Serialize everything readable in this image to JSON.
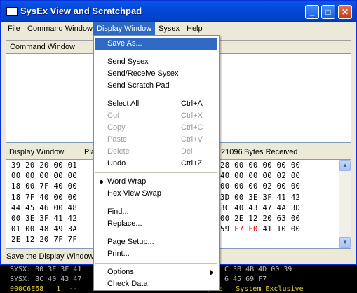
{
  "window": {
    "title": "SysEx View and Scratchpad",
    "buttons": {
      "minimize": "_",
      "maximize": "□",
      "close": "✕"
    }
  },
  "menubar": {
    "items": [
      "File",
      "Command Window",
      "Display Window",
      "Sysex",
      "Help"
    ],
    "active": "Display Window"
  },
  "command_window": {
    "label": "Command Window"
  },
  "display_window": {
    "label": "Display Window",
    "col2": "Pla",
    "bytes_count": "21096",
    "bytes_label": "Bytes Received",
    "hex_left": [
      "39 20 20 00 01",
      "00 00 00 00 00",
      "18 00 7F 40 00",
      "18 7F 40 00 00",
      "44 45 46 00 48",
      "00 3E 3F 41 42",
      "01 00 48 49 3A",
      "2E 12 20 7F 7F"
    ],
    "hex_right": [
      {
        "text": "28 00 00 00 00 00",
        "red": ""
      },
      {
        "text": "40 00 00 00 02 00",
        "red": ""
      },
      {
        "text": "00 00 00 02 00 00",
        "red": ""
      },
      {
        "text": "3D 00 3E 3F 41 42",
        "red": ""
      },
      {
        "text": "3C 40 43 47 4A 3D",
        "red": ""
      },
      {
        "text": "00 2E 12 20 63 00",
        "red": ""
      },
      {
        "text": "59 ",
        "red": "F7 F0",
        "tail": " 41 10 00"
      },
      {
        "text": "",
        "red": ""
      }
    ]
  },
  "statusbar": {
    "text": "Save the Display Window"
  },
  "background_console": {
    "lines": [
      "SYSX: 00 3E 3F 41",
      "SYSX: 3C 40 43 47",
      "000C6E68   1  --"
    ],
    "lines_right": [
      "C 3B 4B 4D 00 39",
      "6 45 69 F7",
      "A4 Bytes   System Exclusive"
    ]
  },
  "dropdown": {
    "items": [
      {
        "label": "Save As...",
        "shortcut": "",
        "disabled": false,
        "selected": true
      },
      {
        "sep": true
      },
      {
        "label": "Send Sysex",
        "shortcut": "",
        "disabled": false
      },
      {
        "label": "Send/Receive Sysex",
        "shortcut": "",
        "disabled": false
      },
      {
        "label": "Send Scratch Pad",
        "shortcut": "",
        "disabled": false
      },
      {
        "sep": true
      },
      {
        "label": "Select All",
        "shortcut": "Ctrl+A",
        "disabled": false
      },
      {
        "label": "Cut",
        "shortcut": "Ctrl+X",
        "disabled": true
      },
      {
        "label": "Copy",
        "shortcut": "Ctrl+C",
        "disabled": true
      },
      {
        "label": "Paste",
        "shortcut": "Ctrl+V",
        "disabled": true
      },
      {
        "label": "Delete",
        "shortcut": "Del",
        "disabled": true
      },
      {
        "label": "Undo",
        "shortcut": "Ctrl+Z",
        "disabled": false
      },
      {
        "sep": true
      },
      {
        "label": "Word Wrap",
        "shortcut": "",
        "disabled": false,
        "checked": true
      },
      {
        "label": "Hex View Swap",
        "shortcut": "",
        "disabled": false
      },
      {
        "sep": true
      },
      {
        "label": "Find...",
        "shortcut": "",
        "disabled": false
      },
      {
        "label": "Replace...",
        "shortcut": "",
        "disabled": false
      },
      {
        "sep": true
      },
      {
        "label": "Page Setup...",
        "shortcut": "",
        "disabled": false
      },
      {
        "label": "Print...",
        "shortcut": "",
        "disabled": false
      },
      {
        "sep": true
      },
      {
        "label": "Options",
        "shortcut": "",
        "disabled": false,
        "submenu": true
      },
      {
        "label": "Check Data",
        "shortcut": "",
        "disabled": false
      }
    ]
  },
  "colors": {
    "title_blue": "#0348d8",
    "menu_highlight": "#316ac5",
    "hex_red": "#d00000"
  }
}
